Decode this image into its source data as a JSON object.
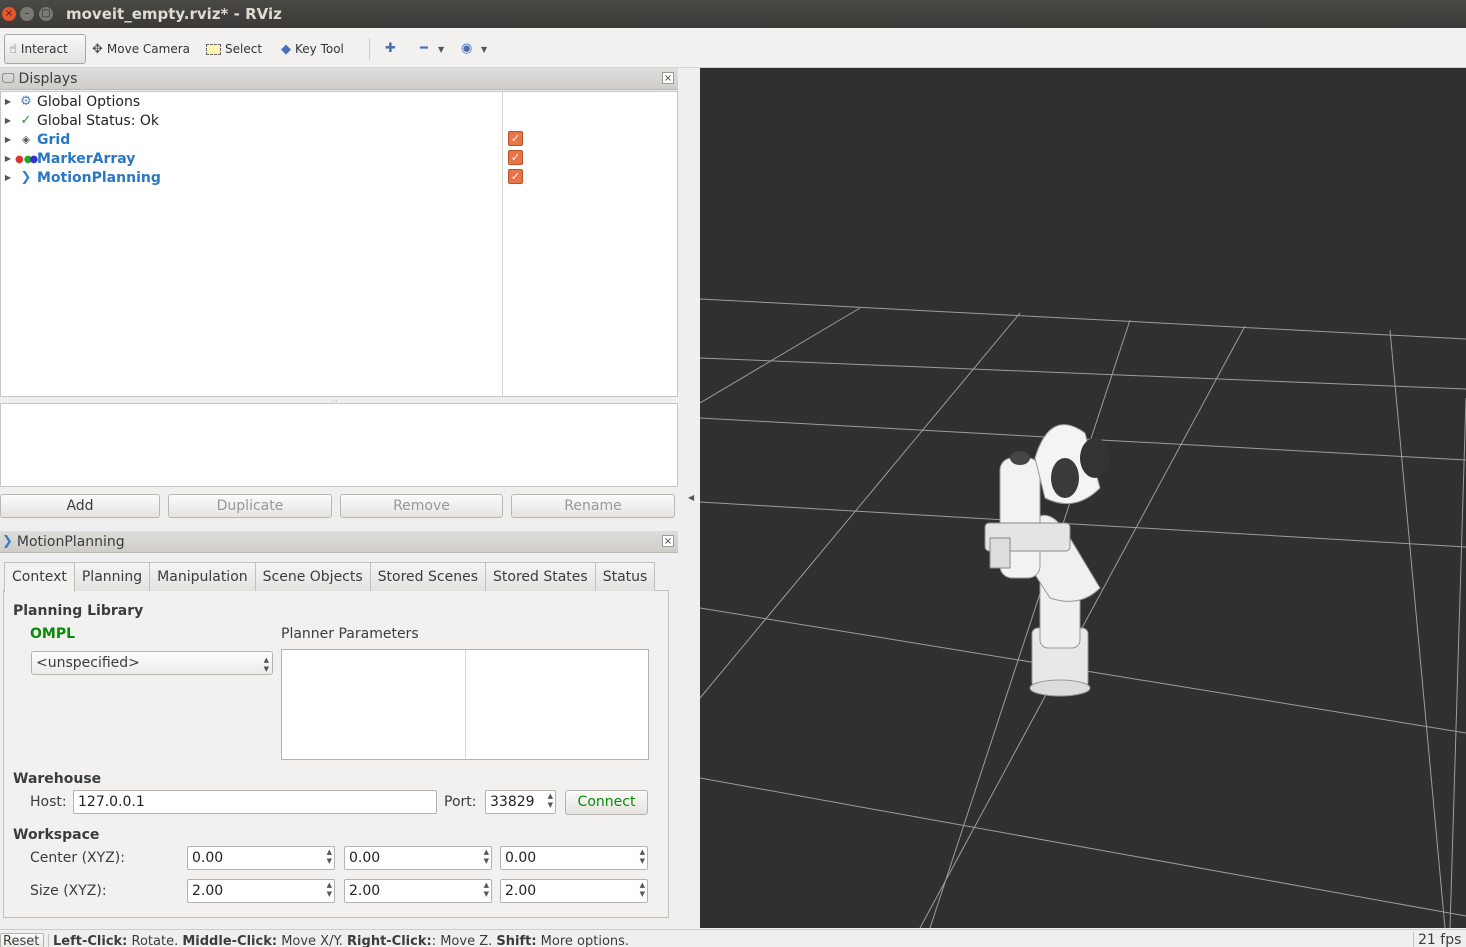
{
  "window": {
    "title": "moveit_empty.rviz* - RViz"
  },
  "toolbar": {
    "interact": "Interact",
    "move_camera": "Move Camera",
    "select": "Select",
    "key_tool": "Key Tool"
  },
  "displays": {
    "title": "Displays",
    "items": [
      {
        "label": "Global Options",
        "icon": "gear-icon"
      },
      {
        "label": "Global Status: Ok",
        "icon": "check-icon"
      },
      {
        "label": "Grid",
        "icon": "grid-icon",
        "checked": true
      },
      {
        "label": "MarkerArray",
        "icon": "marker-array-icon",
        "checked": true
      },
      {
        "label": "MotionPlanning",
        "icon": "motion-planning-icon",
        "checked": true
      }
    ],
    "buttons": {
      "add": "Add",
      "duplicate": "Duplicate",
      "remove": "Remove",
      "rename": "Rename"
    }
  },
  "motion_planning": {
    "title": "MotionPlanning",
    "tabs": [
      "Context",
      "Planning",
      "Manipulation",
      "Scene Objects",
      "Stored Scenes",
      "Stored States",
      "Status"
    ],
    "active_tab": "Context",
    "planning_library": {
      "heading": "Planning Library",
      "library": "OMPL",
      "planner_selected": "<unspecified>",
      "planner_params_label": "Planner Parameters"
    },
    "warehouse": {
      "heading": "Warehouse",
      "host_label": "Host:",
      "host": "127.0.0.1",
      "port_label": "Port:",
      "port": "33829",
      "connect": "Connect"
    },
    "workspace": {
      "heading": "Workspace",
      "center_label": "Center (XYZ):",
      "center": [
        "0.00",
        "0.00",
        "0.00"
      ],
      "size_label": "Size (XYZ):",
      "size": [
        "2.00",
        "2.00",
        "2.00"
      ]
    }
  },
  "statusbar": {
    "reset": "Reset",
    "hint_left_click": "Left-Click:",
    "hint_left_action": "Rotate.",
    "hint_middle_click": "Middle-Click:",
    "hint_middle_action": "Move X/Y.",
    "hint_right_click": "Right-Click:",
    "hint_right_action": ": Move Z.",
    "hint_shift": "Shift:",
    "hint_shift_action": "More options.",
    "fps": "21 fps"
  },
  "colors": {
    "viewport_bg": "#303030",
    "grid_line": "#a0a0a0",
    "checkbox": "#e8754a",
    "link_blue": "#2a77c5",
    "ompl_green": "#0a8a0a"
  }
}
